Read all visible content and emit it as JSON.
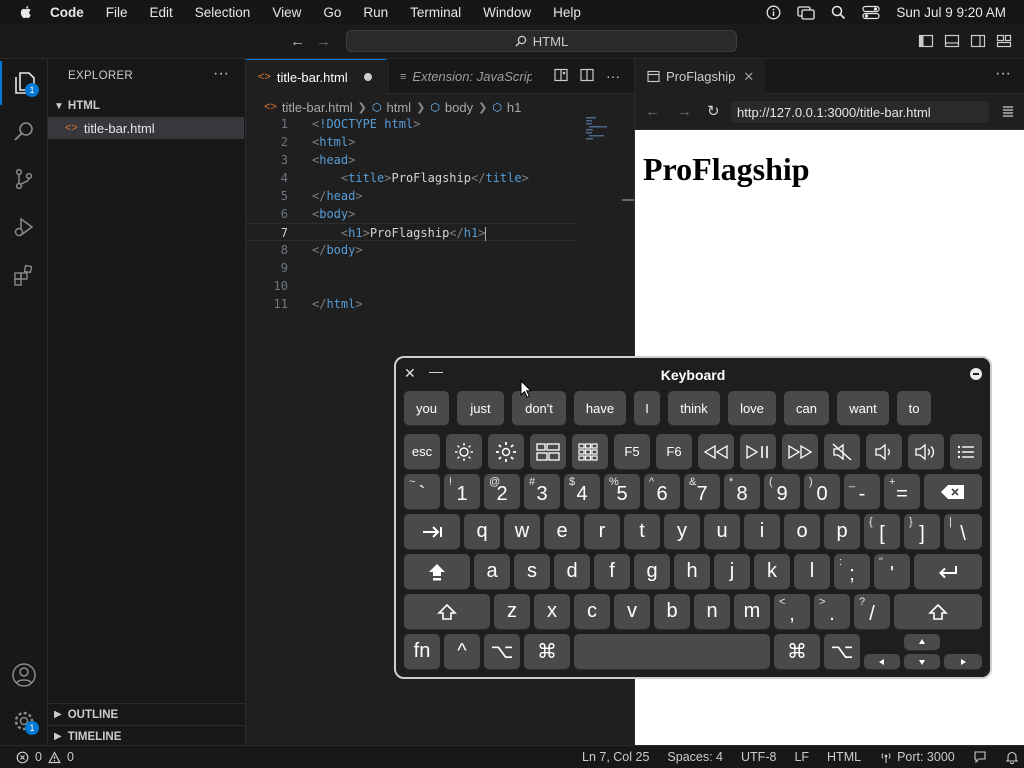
{
  "menubar": {
    "app_name": "Code",
    "items": [
      "File",
      "Edit",
      "Selection",
      "View",
      "Go",
      "Run",
      "Terminal",
      "Window",
      "Help"
    ],
    "datetime": "Sun Jul 9  9:20 AM"
  },
  "titlebar": {
    "search_label": "HTML"
  },
  "activitybar": {
    "explorer_badge": "1",
    "settings_badge": "1"
  },
  "sidebar": {
    "title": "EXPLORER",
    "more": "···",
    "folder": "HTML",
    "file": "title-bar.html",
    "outline": "OUTLINE",
    "timeline": "TIMELINE"
  },
  "editor": {
    "active_tab": "title-bar.html",
    "inactive_tab": "Extension: JavaScript",
    "breadcrumb": [
      "title-bar.html",
      "html",
      "body",
      "h1"
    ],
    "line_numbers": [
      "1",
      "2",
      "3",
      "4",
      "5",
      "6",
      "7",
      "8",
      "9",
      "10",
      "11"
    ],
    "lines": {
      "l1_open": "<",
      "l1_tag": "!DOCTYPE",
      "l1_rest": " html",
      "l1_close": ">",
      "title_text": "ProFlagship",
      "h1_text": "ProFlagship"
    }
  },
  "preview": {
    "tab_label": "ProFlagship",
    "url": "http://127.0.0.1:3000/title-bar.html",
    "heading": "ProFlagship"
  },
  "statusbar": {
    "errors": "0",
    "warnings": "0",
    "position": "Ln 7, Col 25",
    "spaces": "Spaces: 4",
    "encoding": "UTF-8",
    "eol": "LF",
    "language": "HTML",
    "port": "Port: 3000"
  },
  "keyboard": {
    "title": "Keyboard",
    "suggestions": [
      "you",
      "just",
      "don't",
      "have",
      "I",
      "think",
      "love",
      "can",
      "want",
      "to"
    ],
    "fn_row": [
      "esc",
      "brightness-down-icon",
      "brightness-up-icon",
      "mission-control-icon",
      "launchpad-icon",
      "F5",
      "F6",
      "rewind-icon",
      "play-pause-icon",
      "fast-forward-icon",
      "mute-icon",
      "volume-down-icon",
      "volume-up-icon",
      "list-icon"
    ],
    "number_row": [
      {
        "sec": "~",
        "pri": "`"
      },
      {
        "sec": "!",
        "pri": "1"
      },
      {
        "sec": "@",
        "pri": "2"
      },
      {
        "sec": "#",
        "pri": "3"
      },
      {
        "sec": "$",
        "pri": "4"
      },
      {
        "sec": "%",
        "pri": "5"
      },
      {
        "sec": "^",
        "pri": "6"
      },
      {
        "sec": "&",
        "pri": "7"
      },
      {
        "sec": "*",
        "pri": "8"
      },
      {
        "sec": "(",
        "pri": "9"
      },
      {
        "sec": ")",
        "pri": "0"
      },
      {
        "sec": "_",
        "pri": "-"
      },
      {
        "sec": "+",
        "pri": "="
      }
    ],
    "row_q": [
      "q",
      "w",
      "e",
      "r",
      "t",
      "y",
      "u",
      "i",
      "o",
      "p"
    ],
    "row_q_brackets": [
      {
        "sec": "{",
        "pri": "["
      },
      {
        "sec": "}",
        "pri": "]"
      },
      {
        "sec": "|",
        "pri": "\\"
      }
    ],
    "row_a": [
      "a",
      "s",
      "d",
      "f",
      "g",
      "h",
      "j",
      "k",
      "l"
    ],
    "row_a_punct": [
      {
        "sec": ":",
        "pri": ";"
      },
      {
        "sec": "\"",
        "pri": "'"
      }
    ],
    "row_z": [
      "z",
      "x",
      "c",
      "v",
      "b",
      "n",
      "m"
    ],
    "row_z_punct": [
      {
        "sec": "<",
        "pri": ","
      },
      {
        "sec": ">",
        "pri": "."
      },
      {
        "sec": "?",
        "pri": "/"
      }
    ],
    "fn_label": "fn",
    "ctrl_label": "^",
    "opt_label": "⌥",
    "cmd_label": "⌘"
  },
  "colors": {
    "accent": "#0078d4",
    "file_icon": "#e37933",
    "tag": "#569cd6"
  }
}
